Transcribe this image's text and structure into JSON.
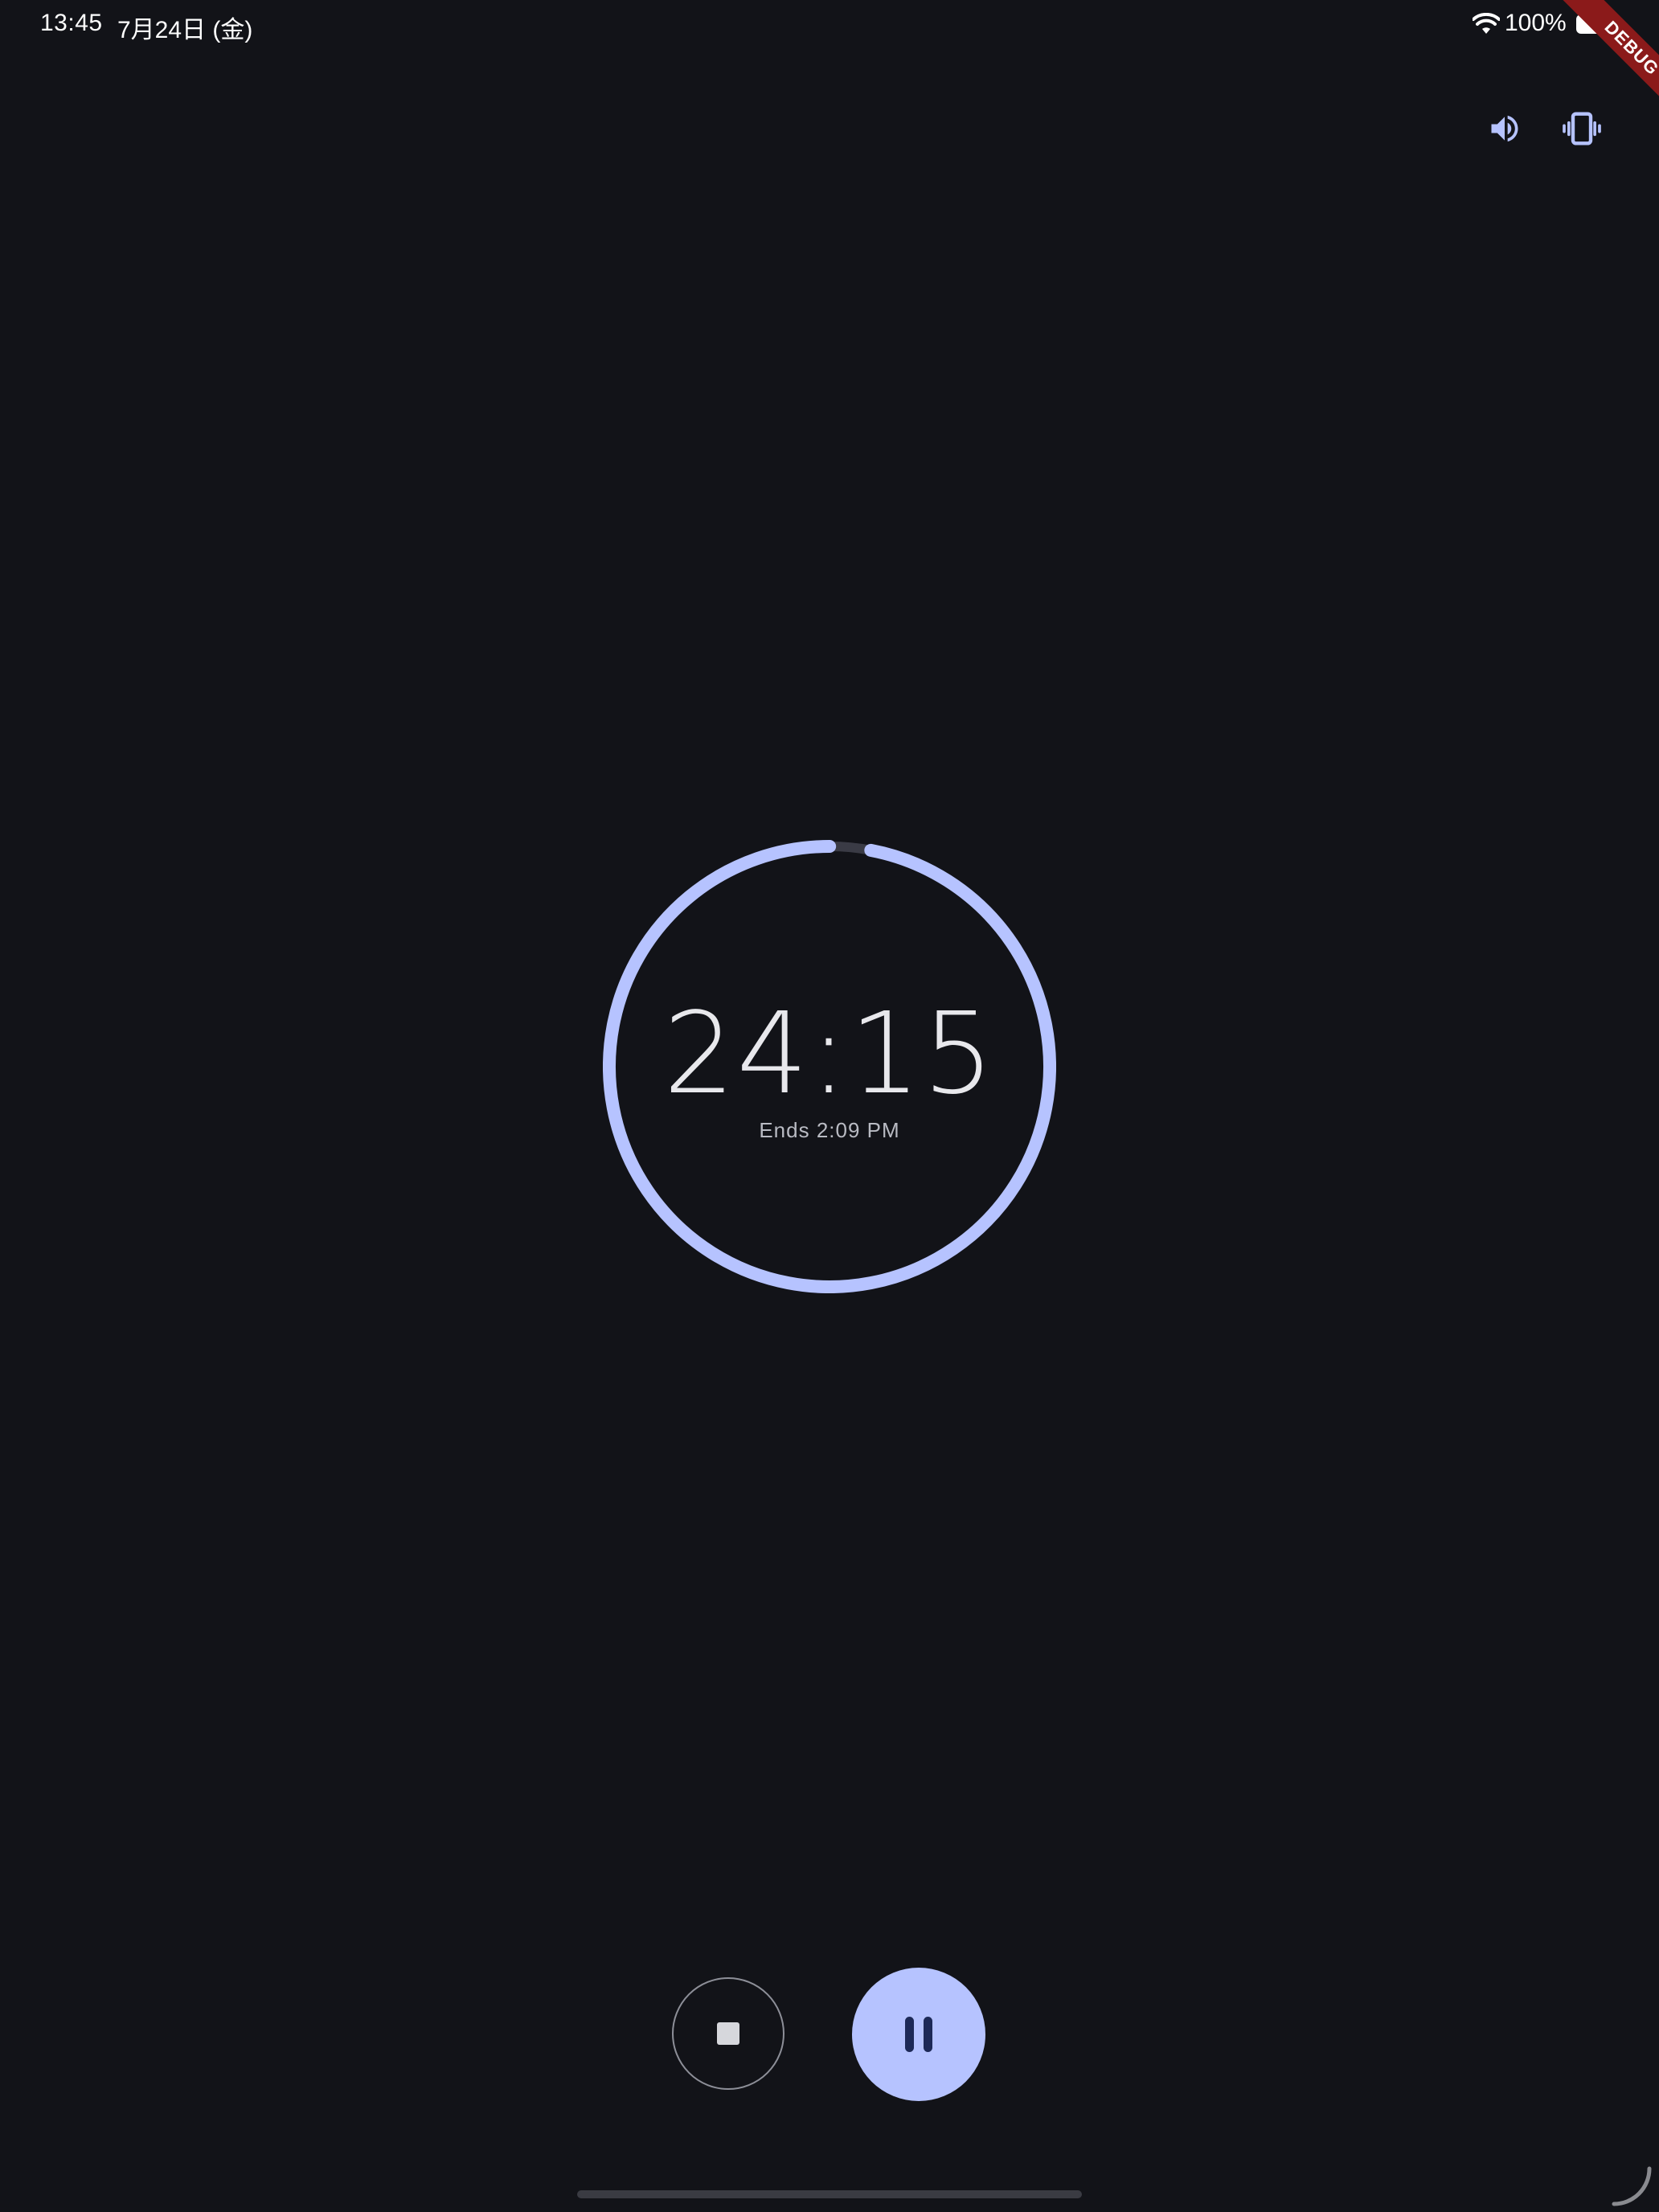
{
  "status_bar": {
    "time": "13:45",
    "date": "7月24日 (金)",
    "battery_percent": "100%",
    "wifi_icon": "wifi-icon",
    "battery_icon": "battery-full-icon"
  },
  "debug_banner": {
    "label": "DEBUG"
  },
  "toolbar": {
    "volume_icon": "volume-up-icon",
    "vibrate_icon": "vibrate-icon"
  },
  "timer": {
    "remaining": "24:15",
    "ends_at": "Ends 2:09 PM",
    "progress_fraction": 0.97,
    "accent_color": "#b6c3ff",
    "track_color": "#3a3b45"
  },
  "controls": {
    "stop_icon": "stop-icon",
    "pause_icon": "pause-icon"
  },
  "colors": {
    "background": "#121318",
    "accent": "#b6c3ff",
    "pause_icon_color": "#1d2957"
  }
}
